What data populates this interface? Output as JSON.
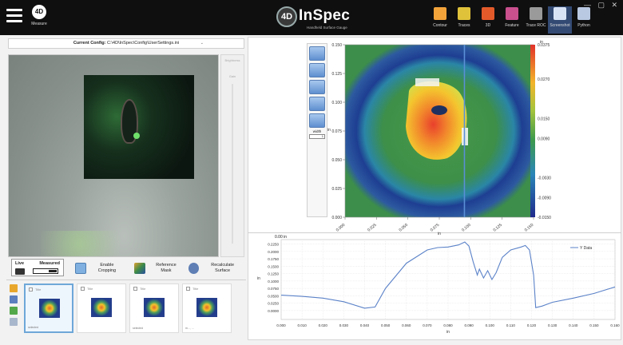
{
  "topbar": {
    "measure_label": "Measure",
    "brand_badge": "4D",
    "brand_name": "InSpec",
    "brand_sub": "Handheld Surface Gauge",
    "tools": [
      {
        "label": "Contour",
        "icon": "contour-icon",
        "color": "#f2a33a"
      },
      {
        "label": "Traces",
        "icon": "traces-icon",
        "color": "#e0c23a"
      },
      {
        "label": "3D",
        "icon": "3d-icon",
        "color": "#e35a2a"
      },
      {
        "label": "Feature",
        "icon": "feature-icon",
        "color": "#c94f8d"
      },
      {
        "label": "Trace ROC",
        "icon": "trace-roc-icon",
        "color": "#9a9a9a"
      },
      {
        "label": "Screenshot",
        "icon": "screenshot-icon",
        "color": "#d8e4f6"
      },
      {
        "label": "Python",
        "icon": "python-icon",
        "color": "#b9c9e2"
      }
    ],
    "active_tool": "Screenshot",
    "window_controls": "— ▢ ✕"
  },
  "config": {
    "label": "Current Config:",
    "path": "C:\\4D\\InSpec\\Config\\UserSettings.ini",
    "caret": "⌄"
  },
  "camera": {
    "slider_label_1": "Brightness",
    "slider_label_2": "Gain"
  },
  "controls": {
    "live": "Live",
    "measured": "Measured",
    "enable_cropping": "Enable Cropping",
    "reference_mask": "Reference Mask",
    "recalculate_surface": "Recalculate Surface"
  },
  "thumbnails": [
    {
      "title": "Title",
      "tag": "selected",
      "selected": true
    },
    {
      "title": "Title",
      "tag": "",
      "selected": false
    },
    {
      "title": "Title",
      "tag": "selected",
      "selected": false
    },
    {
      "title": "Title",
      "tag": "m..., ...",
      "selected": false
    }
  ],
  "plot_tools": {
    "width_label": "width",
    "width_value": "1"
  },
  "chart_data": [
    {
      "type": "heatmap",
      "title": "",
      "x_ticks": [
        0.0,
        0.025,
        0.05,
        0.075,
        0.1,
        0.125,
        0.15
      ],
      "y_ticks": [
        0.0,
        0.025,
        0.05,
        0.075,
        0.1,
        0.125,
        0.15
      ],
      "x_tick_labels": [
        "0.000",
        "0.025",
        "0.050",
        "0.075",
        "0.100",
        "0.125",
        "0.150"
      ],
      "y_tick_labels": [
        "0.000",
        "0.025",
        "0.050",
        "0.075",
        "0.100",
        "0.125",
        "0.150"
      ],
      "xlabel": "in",
      "ylabel": "in",
      "xlim": [
        0.0,
        0.15
      ],
      "ylim": [
        0.0,
        0.15
      ],
      "colorbar_unit": "in",
      "colorbar_ticks": [
        -0.015,
        -0.009,
        -0.003,
        0.009,
        0.015,
        0.027,
        0.0375
      ],
      "colorbar_tick_labels": [
        "-0.0150",
        "-0.0090",
        "-0.0030",
        "0.0090",
        "0.0150",
        "0.0270",
        "0.0375"
      ],
      "colorbar_range": [
        -0.015,
        0.0375
      ],
      "trace_line_x": 0.095,
      "trace_line_color": "#5a8fd6"
    },
    {
      "type": "line",
      "title": "",
      "xlabel": "in",
      "ylabel": "in",
      "y_unit": "0.00 in",
      "xlim": [
        0.0,
        0.16
      ],
      "ylim": [
        -0.03,
        0.24
      ],
      "x_ticks": [
        0.0,
        0.01,
        0.02,
        0.03,
        0.04,
        0.05,
        0.06,
        0.07,
        0.08,
        0.09,
        0.1,
        0.11,
        0.12,
        0.13,
        0.14,
        0.15,
        0.16
      ],
      "x_tick_labels": [
        "0.000",
        "0.010",
        "0.020",
        "0.030",
        "0.040",
        "0.050",
        "0.060",
        "0.070",
        "0.080",
        "0.090",
        "0.100",
        "0.110",
        "0.120",
        "0.130",
        "0.140",
        "0.150",
        "0.160"
      ],
      "y_ticks": [
        0.0,
        0.025,
        0.05,
        0.075,
        0.1,
        0.125,
        0.15,
        0.175,
        0.2,
        0.225
      ],
      "y_tick_labels": [
        "0.0000",
        "0.0250",
        "0.0500",
        "0.0750",
        "0.1000",
        "0.1250",
        "0.1500",
        "0.1750",
        "0.2000",
        "0.2250"
      ],
      "legend_position": "top-right",
      "series": [
        {
          "name": "Y Data",
          "color": "#5b82c8",
          "x": [
            0.0,
            0.01,
            0.02,
            0.03,
            0.04,
            0.045,
            0.05,
            0.06,
            0.07,
            0.075,
            0.08,
            0.085,
            0.088,
            0.09,
            0.092,
            0.094,
            0.095,
            0.097,
            0.099,
            0.101,
            0.103,
            0.106,
            0.11,
            0.115,
            0.117,
            0.119,
            0.121,
            0.122,
            0.125,
            0.13,
            0.14,
            0.15,
            0.16
          ],
          "values": [
            0.052,
            0.048,
            0.042,
            0.03,
            0.008,
            0.012,
            0.075,
            0.16,
            0.205,
            0.213,
            0.215,
            0.222,
            0.232,
            0.218,
            0.165,
            0.12,
            0.14,
            0.11,
            0.135,
            0.105,
            0.128,
            0.18,
            0.205,
            0.215,
            0.22,
            0.205,
            0.12,
            0.01,
            0.015,
            0.028,
            0.042,
            0.058,
            0.08
          ]
        }
      ]
    }
  ]
}
